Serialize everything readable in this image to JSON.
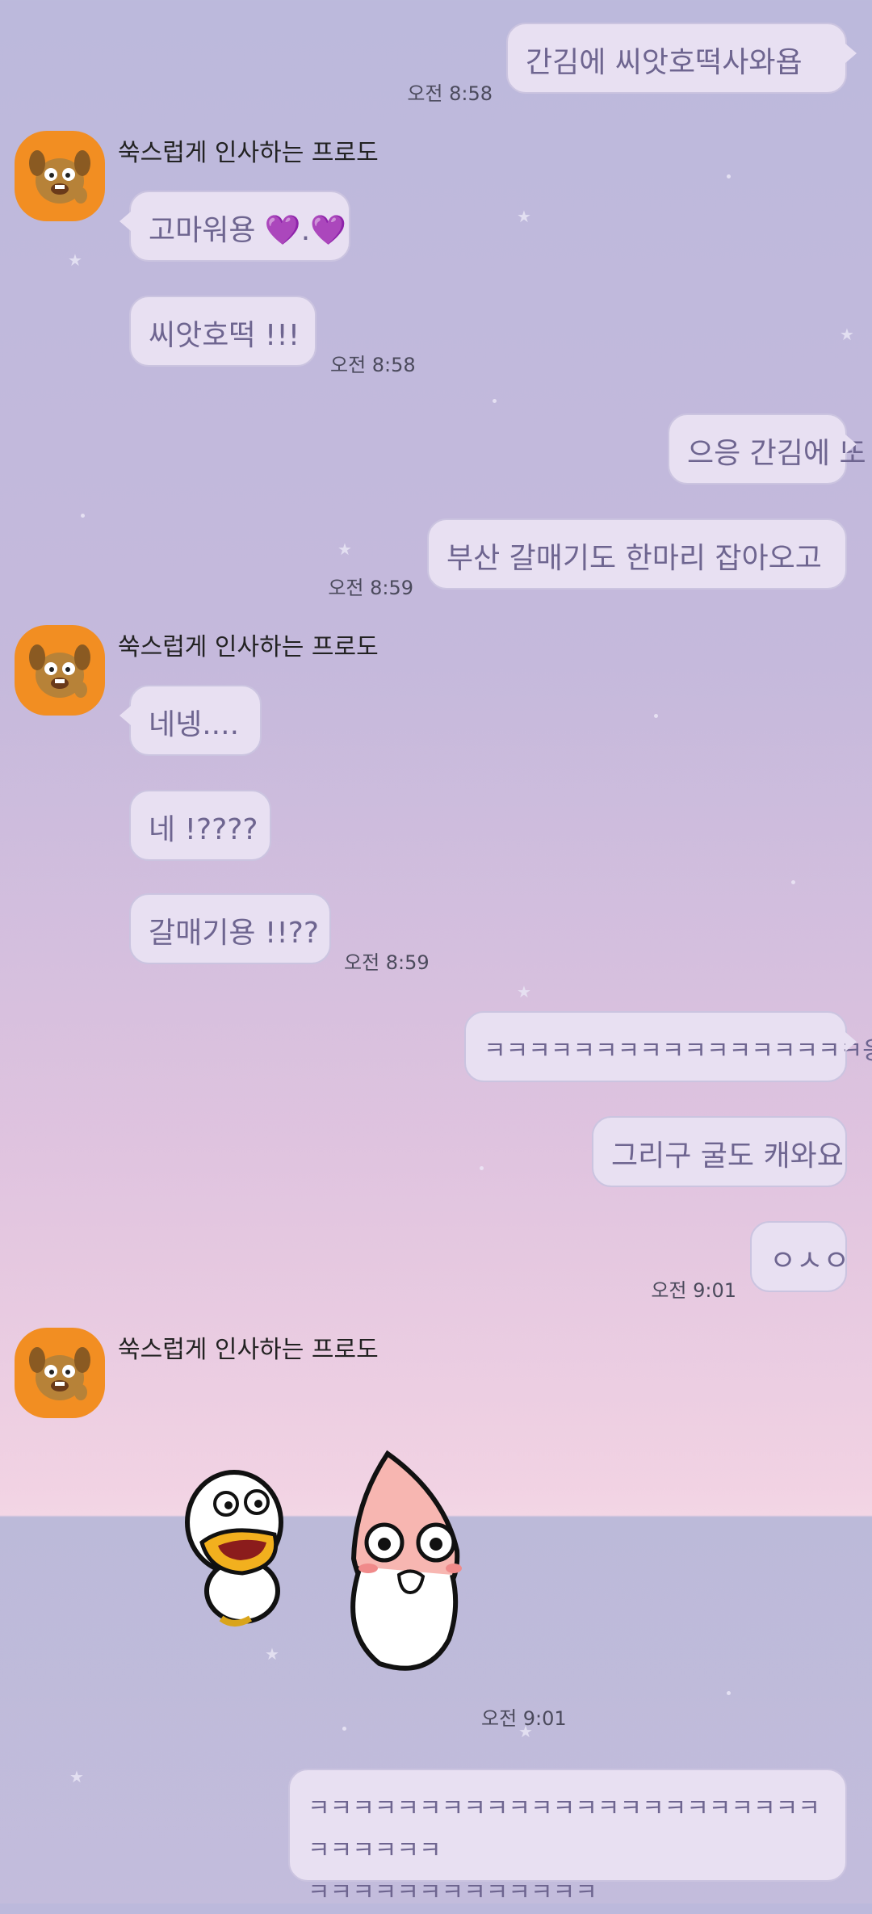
{
  "messages": {
    "m1": {
      "text": "간김에 씨앗호떡사와욥",
      "time": "오전 8:58"
    },
    "sender1": {
      "name": "쑥스럽게 인사하는 프로도",
      "avatar": "frodo-dog-avatar"
    },
    "m2": {
      "text": "고마워용 💜.💜"
    },
    "m3": {
      "text": "씨앗호떡 !!!",
      "time": "오전 8:58"
    },
    "m4": {
      "text": "으응 간김에 또"
    },
    "m5": {
      "text": "부산 갈매기도 한마리 잡아오고",
      "time": "오전 8:59"
    },
    "sender2": {
      "name": "쑥스럽게 인사하는 프로도"
    },
    "m6": {
      "text": "네넹...."
    },
    "m7": {
      "text": "네 !????"
    },
    "m8": {
      "text": "갈매기용 !!??",
      "time": "오전 8:59"
    },
    "m9": {
      "text": "ㅋㅋㅋㅋㅋㅋㅋㅋㅋㅋㅋㅋㅋㅋㅋㅋㅋ웅웅"
    },
    "m10": {
      "text": "그리구 굴도 캐와요"
    },
    "m11": {
      "text": "ㅇㅅㅇ",
      "time": "오전 9:01"
    },
    "sender3": {
      "name": "쑥스럽게 인사하는 프로도"
    },
    "sticker": {
      "icon": "tube-and-apeach-sticker",
      "time": "오전 9:01"
    },
    "m12": {
      "line1": "ㅋㅋㅋㅋㅋㅋㅋㅋㅋㅋㅋㅋㅋㅋㅋㅋㅋㅋㅋㅋㅋㅋㅋㅋㅋㅋㅋㅋㅋ",
      "line2": "ㅋㅋㅋㅋㅋㅋㅋㅋㅋㅋㅋㅋㅋ"
    }
  },
  "colors": {
    "bubble": "#e8e0f2",
    "bubble_text": "#6e6590",
    "avatar_bg": "#f28e22"
  }
}
